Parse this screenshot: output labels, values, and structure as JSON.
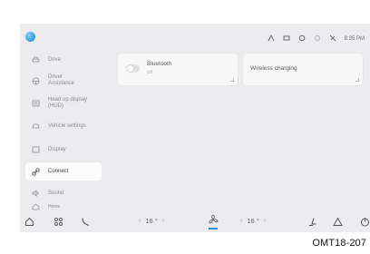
{
  "status_bar": {
    "icons": [
      "profile-icon",
      "eye-icon",
      "media-icon",
      "circle-icon",
      "settings-icon",
      "no-signal-icon"
    ],
    "time": "8:35 PM"
  },
  "sidebar": {
    "items": [
      {
        "label": "Drive",
        "icon": "car-icon"
      },
      {
        "label": "Driver Assistance",
        "icon": "steering-icon"
      },
      {
        "label": "Head up display (HUD)",
        "icon": "hud-icon"
      },
      {
        "label": "Vehicle settings",
        "icon": "vehicle-icon"
      },
      {
        "label": "Display",
        "icon": "display-icon"
      },
      {
        "label": "Connect",
        "icon": "link-icon",
        "selected": true
      },
      {
        "label": "Sound",
        "icon": "speaker-icon"
      },
      {
        "label": "Home",
        "icon": "home-icon"
      }
    ]
  },
  "cards": {
    "bluetooth": {
      "title": "Bluetooth",
      "status": "Off",
      "toggle_on": false
    },
    "wireless_charging": {
      "title": "Wireless charging"
    }
  },
  "dock": {
    "left_temp": "16 °",
    "right_temp": "16 °",
    "chev_left": "‹",
    "chev_right": "›",
    "icons": [
      "home-icon",
      "apps-icon",
      "phone-icon",
      "fan-icon",
      "seat-icon",
      "warning-icon",
      "power-icon"
    ]
  },
  "caption": "OMT18-207",
  "colors": {
    "accent": "#2f8fde",
    "screen_bg": "#ececee",
    "card_bg": "#f7f7f8"
  }
}
